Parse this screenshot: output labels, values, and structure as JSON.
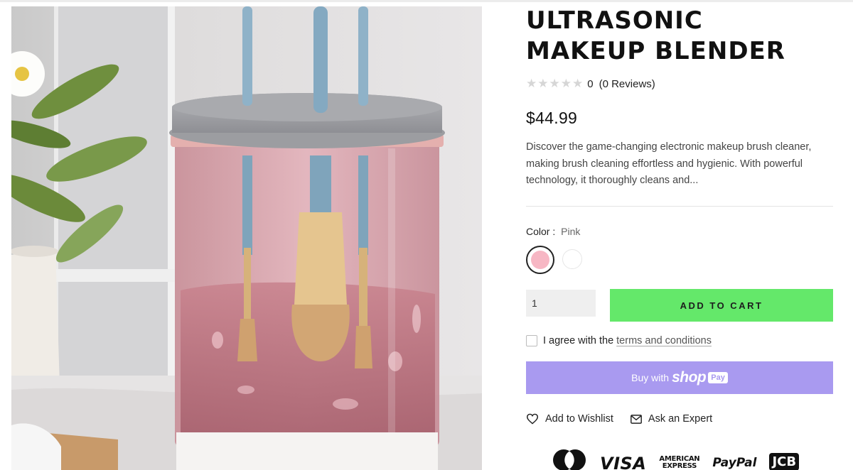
{
  "product": {
    "title": "ULTRASONIC\nMAKEUP BLENDER",
    "rating_count": "0",
    "reviews_label": "(0 Reviews)",
    "price": "$44.99",
    "description": "Discover the game-changing electronic makeup brush cleaner, making brush cleaning effortless and hygienic. With powerful technology, it thoroughly cleans and..."
  },
  "color": {
    "label": "Color :",
    "selected": "Pink",
    "swatches": [
      "pink",
      "white"
    ],
    "colors": {
      "pink": "#f7b7c4",
      "white": "#ffffff"
    }
  },
  "cart": {
    "quantity": "1",
    "add_to_cart_label": "ADD TO CART",
    "accent": "#64e86a"
  },
  "agree": {
    "text": "I agree with the",
    "link": "terms and conditions"
  },
  "shop_pay": {
    "buy_with": "Buy with",
    "brand": "shop",
    "pay": "Pay",
    "accent": "#a99af0"
  },
  "actions": {
    "wishlist_label": "Add to Wishlist",
    "expert_label": "Ask an Expert",
    "wishlist_icon": "heart-icon",
    "expert_icon": "mail-icon"
  },
  "payments": {
    "visa": "VISA",
    "amex_line1": "AMERICAN",
    "amex_line2": "EXPRESS",
    "paypal": "PayPal",
    "jcb": "JCB"
  }
}
